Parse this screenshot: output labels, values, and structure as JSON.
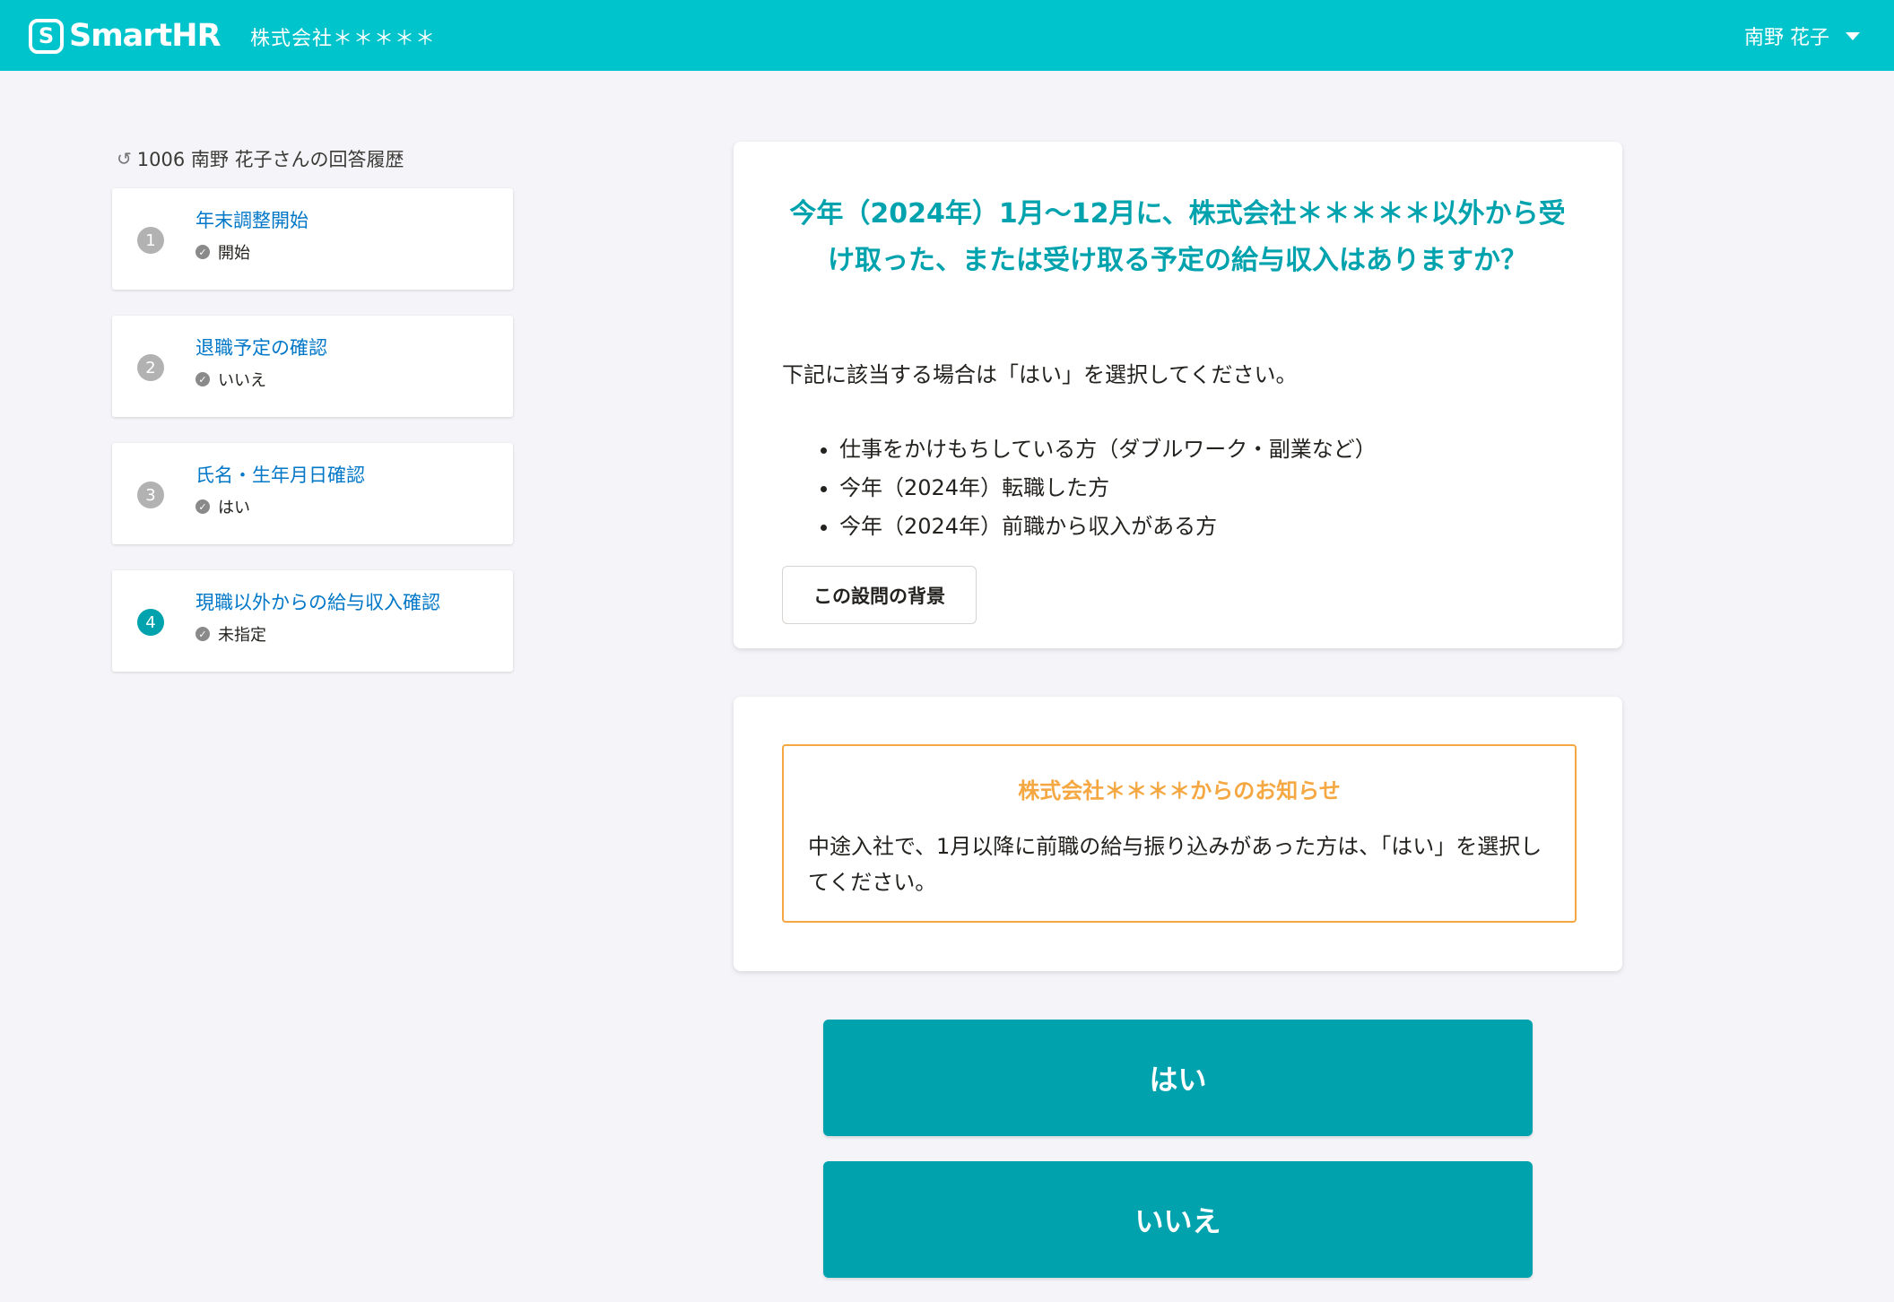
{
  "header": {
    "logo_mark": "S",
    "logo_text": "SmartHR",
    "tenant": "株式会社＊＊＊＊＊",
    "user_name": "南野 花子"
  },
  "sidebar": {
    "history_title": "1006 南野 花子さんの回答履歴",
    "steps": [
      {
        "number": "1",
        "label": "年末調整開始",
        "answer": "開始"
      },
      {
        "number": "2",
        "label": "退職予定の確認",
        "answer": "いいえ"
      },
      {
        "number": "3",
        "label": "氏名・生年月日確認",
        "answer": "はい"
      },
      {
        "number": "4",
        "label": "現職以外からの給与収入確認",
        "answer": "未指定"
      }
    ]
  },
  "question": {
    "title": "今年（2024年）1月〜12月に、株式会社＊＊＊＊＊以外から受け取った、または受け取る予定の給与収入はありますか？",
    "description": "下記に該当する場合は「はい」を選択してください。",
    "conditions": [
      "仕事をかけもちしている方（ダブルワーク・副業など）",
      "今年（2024年）転職した方",
      "今年（2024年）前職から収入がある方"
    ],
    "background_button": "この設問の背景"
  },
  "notice": {
    "title": "株式会社＊＊＊＊からのお知らせ",
    "body": "中途入社で、1月以降に前職の給与振り込みがあった方は、「はい」を選択してください。"
  },
  "answers": {
    "yes": "はい",
    "no": "いいえ"
  },
  "colors": {
    "header": "#00c4cc",
    "accent": "#00a3ad",
    "notice": "#f5a742",
    "link": "#0077c7"
  }
}
